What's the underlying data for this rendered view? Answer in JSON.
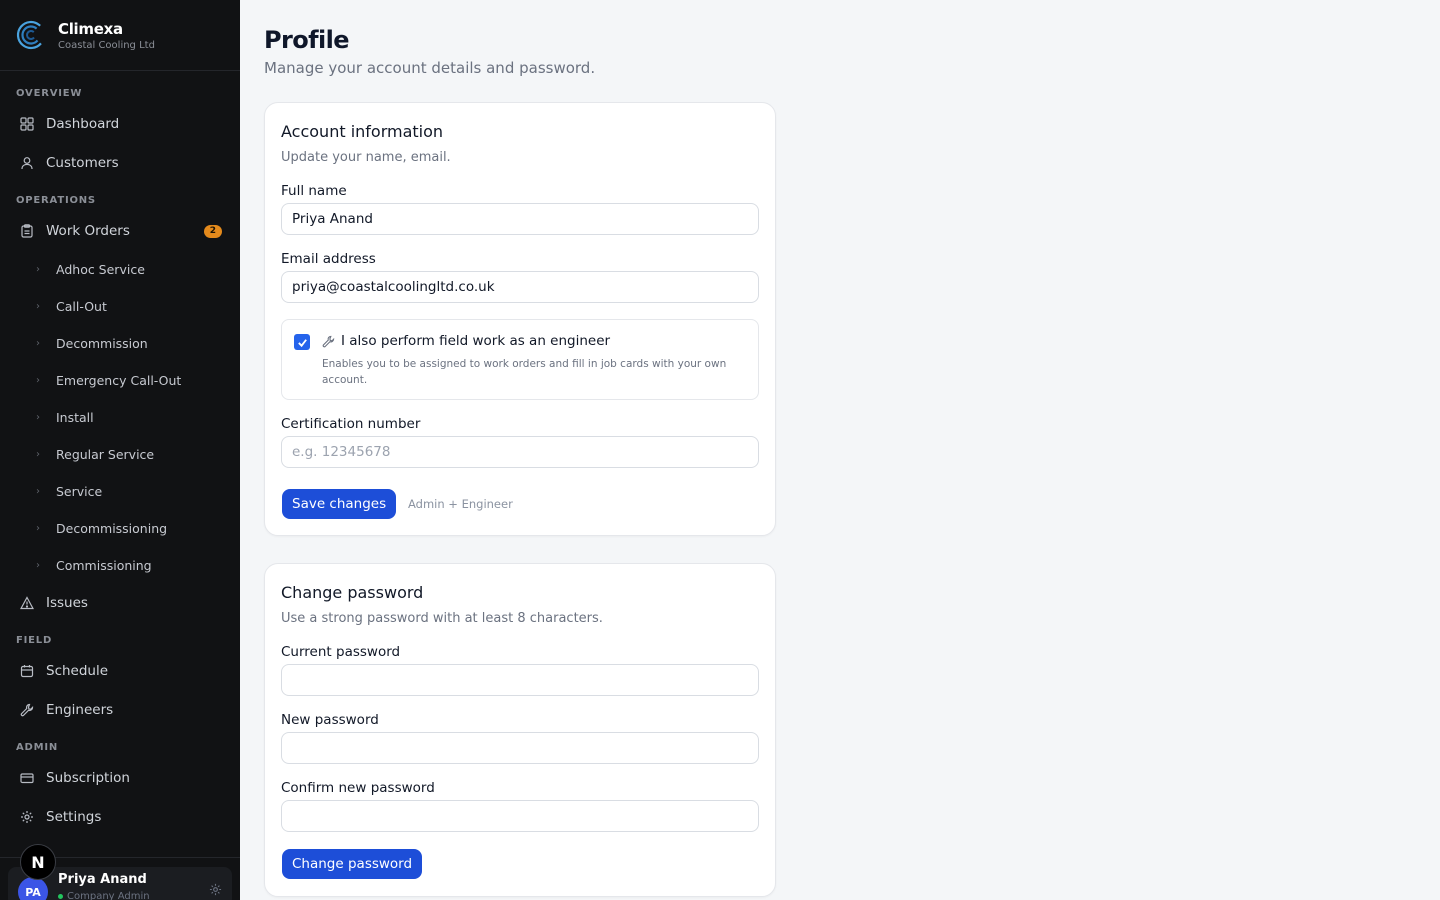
{
  "brand": {
    "name": "Climexa",
    "company": "Coastal Cooling Ltd"
  },
  "sidebar": {
    "sections": {
      "overview": "OVERVIEW",
      "operations": "OPERATIONS",
      "field": "FIELD",
      "admin": "ADMIN"
    },
    "items": {
      "dashboard": "Dashboard",
      "customers": "Customers",
      "work_orders": "Work Orders",
      "work_orders_badge": "2",
      "issues": "Issues",
      "schedule": "Schedule",
      "engineers": "Engineers",
      "subscription": "Subscription",
      "settings": "Settings"
    },
    "work_order_types": [
      "Adhoc Service",
      "Call-Out",
      "Decommission",
      "Emergency Call-Out",
      "Install",
      "Regular Service",
      "Service",
      "Decommissioning",
      "Commissioning"
    ]
  },
  "user": {
    "initials": "PA",
    "name": "Priya Anand",
    "role": "Company Admin"
  },
  "dev_badge": "N",
  "page": {
    "title": "Profile",
    "subtitle": "Manage your account details and password."
  },
  "account": {
    "title": "Account information",
    "subtitle": "Update your name, email.",
    "full_name_label": "Full name",
    "full_name_value": "Priya Anand",
    "email_label": "Email address",
    "email_value": "priya@coastalcoolingltd.co.uk",
    "engineer_checkbox_label": "I also perform field work as an engineer",
    "engineer_checkbox_checked": true,
    "engineer_checkbox_desc": "Enables you to be assigned to work orders and fill in job cards with your own account.",
    "cert_label": "Certification number",
    "cert_placeholder": "e.g. 12345678",
    "save_label": "Save changes",
    "role_note": "Admin + Engineer"
  },
  "password": {
    "title": "Change password",
    "subtitle": "Use a strong password with at least 8 characters.",
    "current_label": "Current password",
    "new_label": "New password",
    "confirm_label": "Confirm new password",
    "submit_label": "Change password"
  },
  "colors": {
    "sidebar_bg": "#111214",
    "accent": "#1d4ed8",
    "badge": "#e48a1c",
    "page_bg": "#f4f6f8"
  }
}
